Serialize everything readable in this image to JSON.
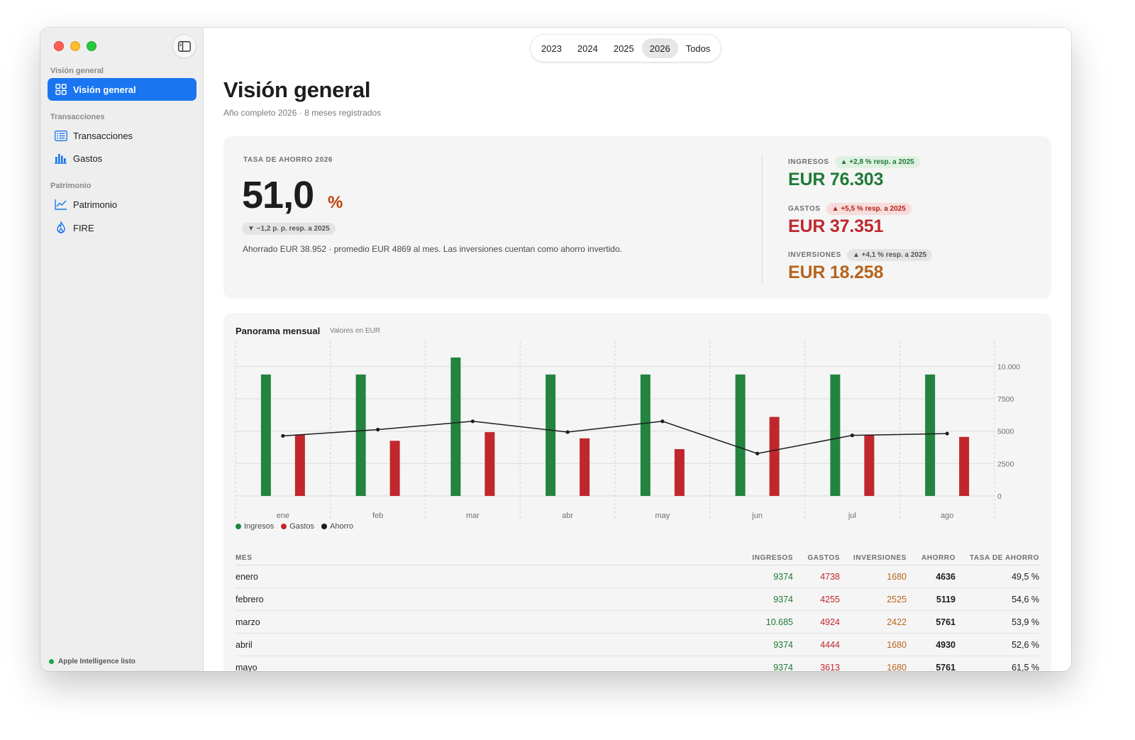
{
  "sidebar": {
    "sections": [
      {
        "label": "Visión general",
        "items": [
          {
            "label": "Visión general",
            "icon": "grid-icon",
            "active": true
          }
        ]
      },
      {
        "label": "Transacciones",
        "items": [
          {
            "label": "Transacciones",
            "icon": "list-icon"
          },
          {
            "label": "Gastos",
            "icon": "bar-chart-icon"
          }
        ]
      },
      {
        "label": "Patrimonio",
        "items": [
          {
            "label": "Patrimonio",
            "icon": "line-chart-icon"
          },
          {
            "label": "FIRE",
            "icon": "flame-icon"
          }
        ]
      }
    ],
    "status": "Apple Intelligence listo"
  },
  "year_selector": {
    "options": [
      "2023",
      "2024",
      "2025",
      "2026",
      "Todos"
    ],
    "selected": "2026"
  },
  "header": {
    "title": "Visión general",
    "subtitle": "Año completo 2026 · 8 meses registrados"
  },
  "summary": {
    "rate_caption": "TASA DE AHORRO 2026",
    "rate_value": "51,0",
    "rate_unit": "%",
    "rate_delta": "▼ −1,2 p. p. resp. a 2025",
    "note": "Ahorrado EUR 38.952 · promedio EUR 4869 al mes. Las inversiones cuentan como ahorro invertido.",
    "metrics": [
      {
        "label": "INGRESOS",
        "delta": "▲ +2,8 % resp. a 2025",
        "value": "EUR 76.303",
        "color": "#1e7a36",
        "pill": "green"
      },
      {
        "label": "GASTOS",
        "delta": "▲ +5,5 % resp. a 2025",
        "value": "EUR 37.351",
        "color": "#c0272d",
        "pill": "red"
      },
      {
        "label": "INVERSIONES",
        "delta": "▲ +4,1 % resp. a 2025",
        "value": "EUR 18.258",
        "color": "#b5651d",
        "pill": "gray"
      }
    ]
  },
  "chart": {
    "title": "Panorama mensual",
    "unit": "Valores en EUR",
    "legend": [
      {
        "label": "Ingresos",
        "color": "#22843d"
      },
      {
        "label": "Gastos",
        "color": "#c0272d"
      },
      {
        "label": "Ahorro",
        "color": "#1d1d1f"
      }
    ]
  },
  "chart_data": {
    "type": "bar",
    "categories": [
      "ene",
      "feb",
      "mar",
      "abr",
      "may",
      "jun",
      "jul",
      "ago"
    ],
    "series": [
      {
        "name": "Ingresos",
        "type": "bar",
        "values": [
          9374,
          9374,
          10685,
          9374,
          9374,
          9374,
          9374,
          9374
        ]
      },
      {
        "name": "Gastos",
        "type": "bar",
        "values": [
          4738,
          4255,
          4924,
          4444,
          3613,
          6100,
          4700,
          4560
        ]
      },
      {
        "name": "Ahorro",
        "type": "line",
        "values": [
          4636,
          5119,
          5761,
          4930,
          5761,
          3274,
          4674,
          4814
        ]
      }
    ],
    "y_ticks": [
      "10.000",
      "7500",
      "5000",
      "2500",
      "0"
    ],
    "ylim": [
      0,
      11500
    ],
    "grid": true,
    "legend_position": "bottom-left"
  },
  "table": {
    "headers": [
      "MES",
      "INGRESOS",
      "GASTOS",
      "INVERSIONES",
      "AHORRO",
      "TASA DE AHORRO"
    ],
    "rows": [
      [
        "enero",
        "9374",
        "4738",
        "1680",
        "4636",
        "49,5 %"
      ],
      [
        "febrero",
        "9374",
        "4255",
        "2525",
        "5119",
        "54,6 %"
      ],
      [
        "marzo",
        "10.685",
        "4924",
        "2422",
        "5761",
        "53,9 %"
      ],
      [
        "abril",
        "9374",
        "4444",
        "1680",
        "4930",
        "52,6 %"
      ],
      [
        "mayo",
        "9374",
        "3613",
        "1680",
        "5761",
        "61,5 %"
      ]
    ]
  }
}
